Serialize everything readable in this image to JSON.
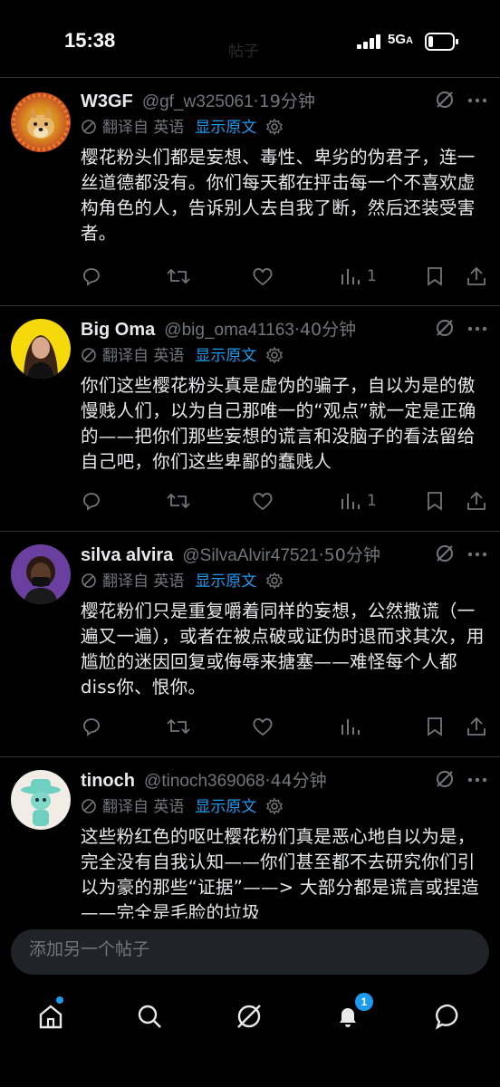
{
  "status_bar": {
    "time": "15:38",
    "faded_title": "帖子",
    "network": "5G",
    "network_suffix": "A"
  },
  "translate": {
    "prefix": "翻译自 英语",
    "show_original": "显示原文"
  },
  "tweets": [
    {
      "display_name": "W3GF",
      "handle": "@gf_w325061",
      "time": "19分钟",
      "body": "樱花粉头们都是妄想、毒性、卑劣的伪君子，连一丝道德都没有。你们每天都在抨击每一个不喜欢虚构角色的人，告诉别人去自我了断，然后还装受害者。",
      "views": "1"
    },
    {
      "display_name": "Big Oma",
      "handle": "@big_oma41163",
      "time": "40分钟",
      "body": "你们这些樱花粉头真是虚伪的骗子，自以为是的傲慢贱人们，以为自己那唯一的“观点”就一定是正确的——把你们那些妄想的谎言和没脑子的看法留给自己吧，你们这些卑鄙的蠢贱人",
      "views": "1"
    },
    {
      "display_name": "silva alvira",
      "handle": "@SilvaAlvir47521",
      "time": "50分钟",
      "body": "樱花粉们只是重复嚼着同样的妄想，公然撒谎（一遍又一遍），或者在被点破或证伪时退而求其次，用尴尬的迷因回复或侮辱来搪塞——难怪每个人都diss你、恨你。",
      "views": ""
    },
    {
      "display_name": "tinoch",
      "handle": "@tinoch369068",
      "time": "44分钟",
      "body": "这些粉红色的呕吐樱花粉们真是恶心地自以为是，完全没有自我认知——你们甚至都不去研究你们引以为豪的那些“证据”——> 大部分都是谎言或捏造——完全是毛脸的垃圾",
      "views": ""
    }
  ],
  "reply": {
    "placeholder": "添加另一个帖子"
  },
  "tab_bar": {
    "notification_count": "1"
  },
  "colors": {
    "accent": "#1d9bf0",
    "muted": "#71767b",
    "divider": "#2f3336",
    "background": "#000000"
  }
}
